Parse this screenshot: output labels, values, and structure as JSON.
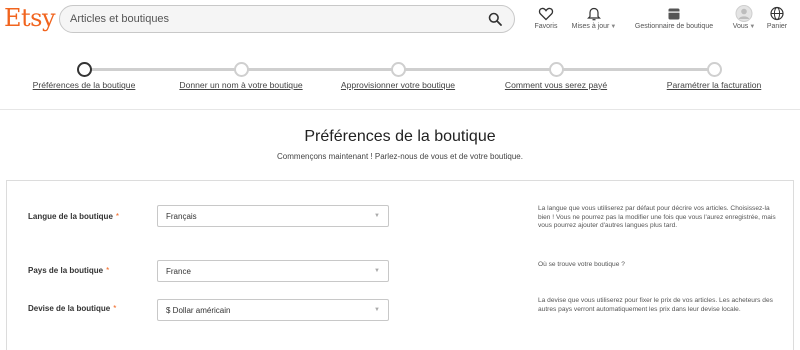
{
  "header": {
    "logo": "Etsy",
    "search_placeholder": "Articles et boutiques",
    "nav": [
      {
        "icon": "heart-icon",
        "label": "Favoris"
      },
      {
        "icon": "bell-icon",
        "label": "Mises à jour"
      },
      {
        "icon": "shop-icon",
        "label": "Gestionnaire de boutique"
      },
      {
        "icon": "avatar-icon",
        "label": "Vous"
      },
      {
        "icon": "globe-icon",
        "label": "Panier"
      }
    ]
  },
  "stepper": {
    "steps": [
      {
        "label": "Préférences de la boutique",
        "active": true
      },
      {
        "label": "Donner un nom à votre boutique",
        "active": false
      },
      {
        "label": "Approvisionner votre boutique",
        "active": false
      },
      {
        "label": "Comment vous serez payé",
        "active": false
      },
      {
        "label": "Paramétrer la facturation",
        "active": false
      }
    ]
  },
  "main": {
    "title": "Préférences de la boutique",
    "subtitle": "Commençons maintenant ! Parlez-nous de vous et de votre boutique.",
    "fields": [
      {
        "label": "Langue de la boutique",
        "required_mark": "*",
        "value": "Français",
        "help": "La langue que vous utiliserez par défaut pour décrire vos articles. Choisissez-la bien ! Vous ne pourrez pas la modifier une fois que vous l'aurez enregistrée, mais vous pourrez ajouter d'autres langues plus tard."
      },
      {
        "label": "Pays de la boutique",
        "required_mark": "*",
        "value": "France",
        "help": "Où se trouve votre boutique ?"
      },
      {
        "label": "Devise de la boutique",
        "required_mark": "*",
        "value": "$ Dollar américain",
        "help": "La devise que vous utiliserez pour fixer le prix de vos articles. Les acheteurs des autres pays verront automatiquement les prix dans leur devise locale."
      }
    ]
  },
  "colors": {
    "brand": "#f1641e",
    "required": "#f1641e",
    "step_active": "#333333",
    "step_inactive": "#cfcfcf"
  }
}
